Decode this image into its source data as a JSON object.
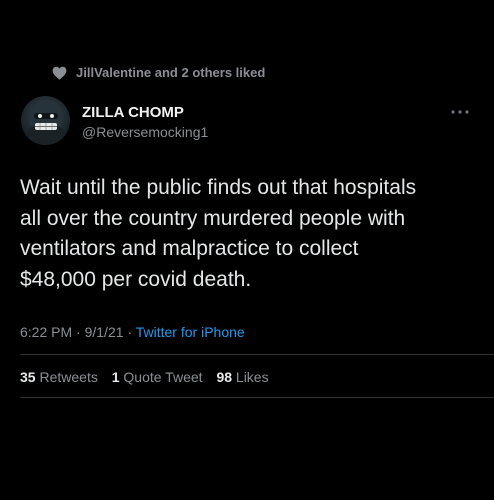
{
  "social_context": {
    "icon": "heart-icon",
    "text": "JillValentine and 2 others liked"
  },
  "author": {
    "display_name": "ZILLA CHOMP",
    "handle": "@Reversemocking1",
    "avatar_icon": "masked-face-avatar"
  },
  "menu": {
    "icon": "more-options-icon"
  },
  "tweet": {
    "lines": [
      "Wait until the public finds out that hospitals",
      "all over the country murdered  people with",
      "ventilators and malpractice to collect",
      "$48,000 per covid death."
    ],
    "time": "6:22 PM",
    "date": "9/1/21",
    "separator": "·",
    "source": "Twitter for iPhone"
  },
  "stats": {
    "retweets_count": "35",
    "retweets_label": "Retweets",
    "quotes_count": "1",
    "quotes_label": "Quote Tweet",
    "likes_count": "98",
    "likes_label": "Likes"
  },
  "colors": {
    "background": "#000000",
    "text": "#e7e9ea",
    "secondary": "#8b8f94",
    "link": "#1d9bf0",
    "divider": "#2f3336"
  }
}
